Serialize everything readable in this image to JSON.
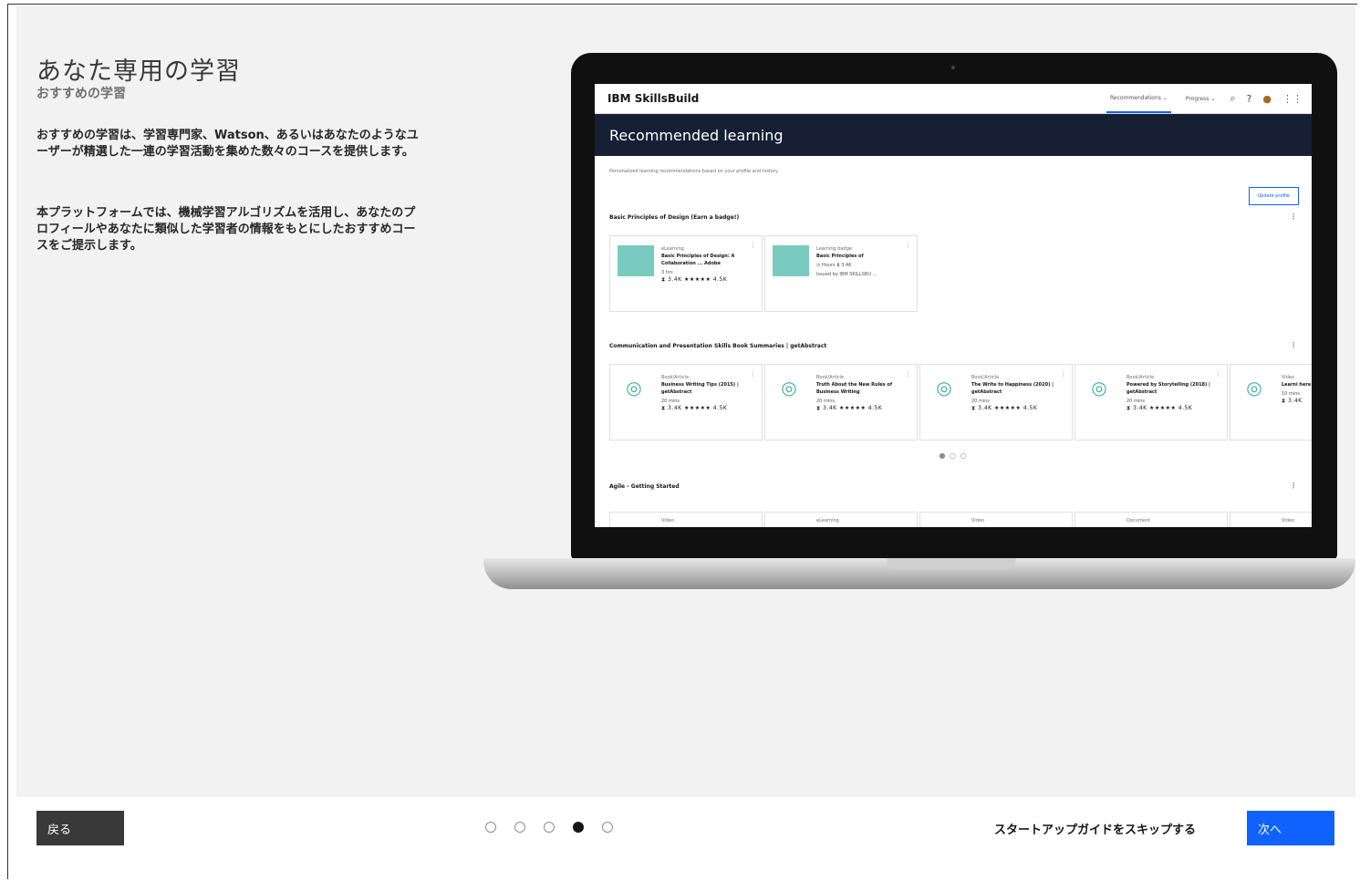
{
  "intro": {
    "title": "あなた専用の学習",
    "subtitle": "おすすめの学習",
    "paragraph1": "おすすめの学習は、学習専門家、Watson、あるいはあなたのようなユーザーが精選した一連の学習活動を集めた数々のコースを提供します。",
    "paragraph2": "本プラットフォームでは、機械学習アルゴリズムを活用し、あなたのプロフィールやあなたに類似した学習者の情報をもとにしたおすすめコースをご提示します。"
  },
  "screen": {
    "brand": "IBM SkillsBuild",
    "nav": [
      "Recommendations ⌄",
      "Progress ⌄"
    ],
    "banner": "Recommended learning",
    "description": "Personalized learning recommendations based on your profile and history",
    "update_button": "Update profile",
    "sections": [
      {
        "title": "Basic Principles of Design (Earn a badge!)",
        "cards": [
          {
            "type": "eLearning",
            "name": "Basic Principles of Design: A Collaboration ... Adobe",
            "meta": "3 hrs",
            "rating": "⧗ 3.4K ★★★★★ 4.5K"
          },
          {
            "type": "Learning badge",
            "name": "Basic Principles of",
            "meta": "◷ Hours  ⧗ 3.4K",
            "rating": "Issued by IBM SKILLSBU ..."
          }
        ]
      },
      {
        "title": "Communication and Presentation Skills Book Summaries | getAbstract",
        "cards": [
          {
            "type": "Book/Article",
            "name": "Business Writing Tips (2015) | getAbstract",
            "meta": "20 mins",
            "rating": "⧗ 3.4K ★★★★★ 4.5K"
          },
          {
            "type": "Book/Article",
            "name": "Truth About the New Rules of Business Writing",
            "meta": "20 mins",
            "rating": "⧗ 3.4K ★★★★★ 4.5K"
          },
          {
            "type": "Book/Article",
            "name": "The Write to Happiness (2020) | getAbstract",
            "meta": "20 mins",
            "rating": "⧗ 3.4K ★★★★★ 4.5K"
          },
          {
            "type": "Book/Article",
            "name": "Powered by Storytelling (2018) | getAbstract",
            "meta": "20 mins",
            "rating": "⧗ 3.4K ★★★★★ 4.5K"
          },
          {
            "type": "Video",
            "name": "Learni here sp",
            "meta": "10 mins",
            "rating": "⧗ 3.4K"
          }
        ]
      },
      {
        "title": "Agile - Getting Started",
        "cards": [
          {
            "type": "Video"
          },
          {
            "type": "eLearning"
          },
          {
            "type": "Video"
          },
          {
            "type": "Document"
          },
          {
            "type": "Video"
          }
        ]
      }
    ]
  },
  "footer": {
    "back_label": "戻る",
    "skip_label": "スタートアップガイドをスキップする",
    "next_label": "次へ",
    "pager_total": 5,
    "pager_current": 4
  },
  "colors": {
    "primary": "#0f62fe",
    "banner": "#161f33",
    "back": "#393939"
  }
}
